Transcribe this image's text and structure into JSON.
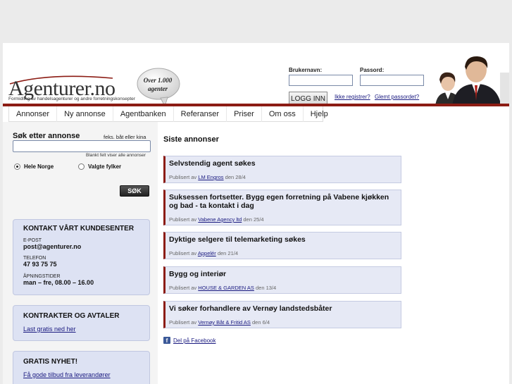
{
  "logo": {
    "name": "Agenturer.no",
    "tagline": "Formidling av handelsagenturer og andre forretningskonsepter"
  },
  "bubble": {
    "line1": "Over 1.000",
    "line2": "agenter"
  },
  "login": {
    "username_label": "Brukernavn:",
    "password_label": "Passord:",
    "username_value": "",
    "password_value": "",
    "button": "LOGG INN",
    "register_link": "Ikke registrer?",
    "forgot_link": "Glemt passordet?"
  },
  "nav": [
    "Annonser",
    "Ny annonse",
    "Agentbanken",
    "Referanser",
    "Priser",
    "Om oss",
    "Hjelp"
  ],
  "search": {
    "title": "Søk etter annonse",
    "hint": "feks. båt eller kina",
    "value": "",
    "note": "Blankt felt viser alle annonser",
    "radio_all": "Hele Norge",
    "radio_selected": "Valgte fylker",
    "button": "SØK"
  },
  "contact": {
    "title": "KONTAKT VÅRT KUNDESENTER",
    "email_label": "E-POST",
    "email": "post@agenturer.no",
    "phone_label": "TELEFON",
    "phone": "47 93 75 75",
    "hours_label": "ÅPNINGSTIDER",
    "hours": "man – fre, 08.00 – 16.00"
  },
  "contracts": {
    "title": "KONTRAKTER OG AVTALER",
    "link": "Last gratis ned her"
  },
  "news": {
    "title": "GRATIS NYHET!",
    "link": "Få gode tilbud fra leverandører"
  },
  "main": {
    "title": "Siste annonser",
    "ads": [
      {
        "title": "Selvstendig agent søkes",
        "prefix": "Publisert av",
        "company": "LM Engros",
        "date": "den 28/4"
      },
      {
        "title": "Suksessen fortsetter. Bygg egen forretning på Vabene kjøkken og bad - ta kontakt i dag",
        "prefix": "Publisert av",
        "company": "Vabene Agency ltd",
        "date": "den 25/4"
      },
      {
        "title": "Dyktige selgere til telemarketing søkes",
        "prefix": "Publisert av",
        "company": "Appelér",
        "date": "den 21/4"
      },
      {
        "title": "Bygg og interiør",
        "prefix": "Publisert av",
        "company": "HOUSE & GARDEN AS",
        "date": "den 13/4"
      },
      {
        "title": "Vi søker forhandlere av Vernøy landstedsbåter",
        "prefix": "Publisert av",
        "company": "Vernøy Båt & Fritid AS",
        "date": "den 6/4"
      }
    ],
    "share": "Del på Facebook"
  }
}
